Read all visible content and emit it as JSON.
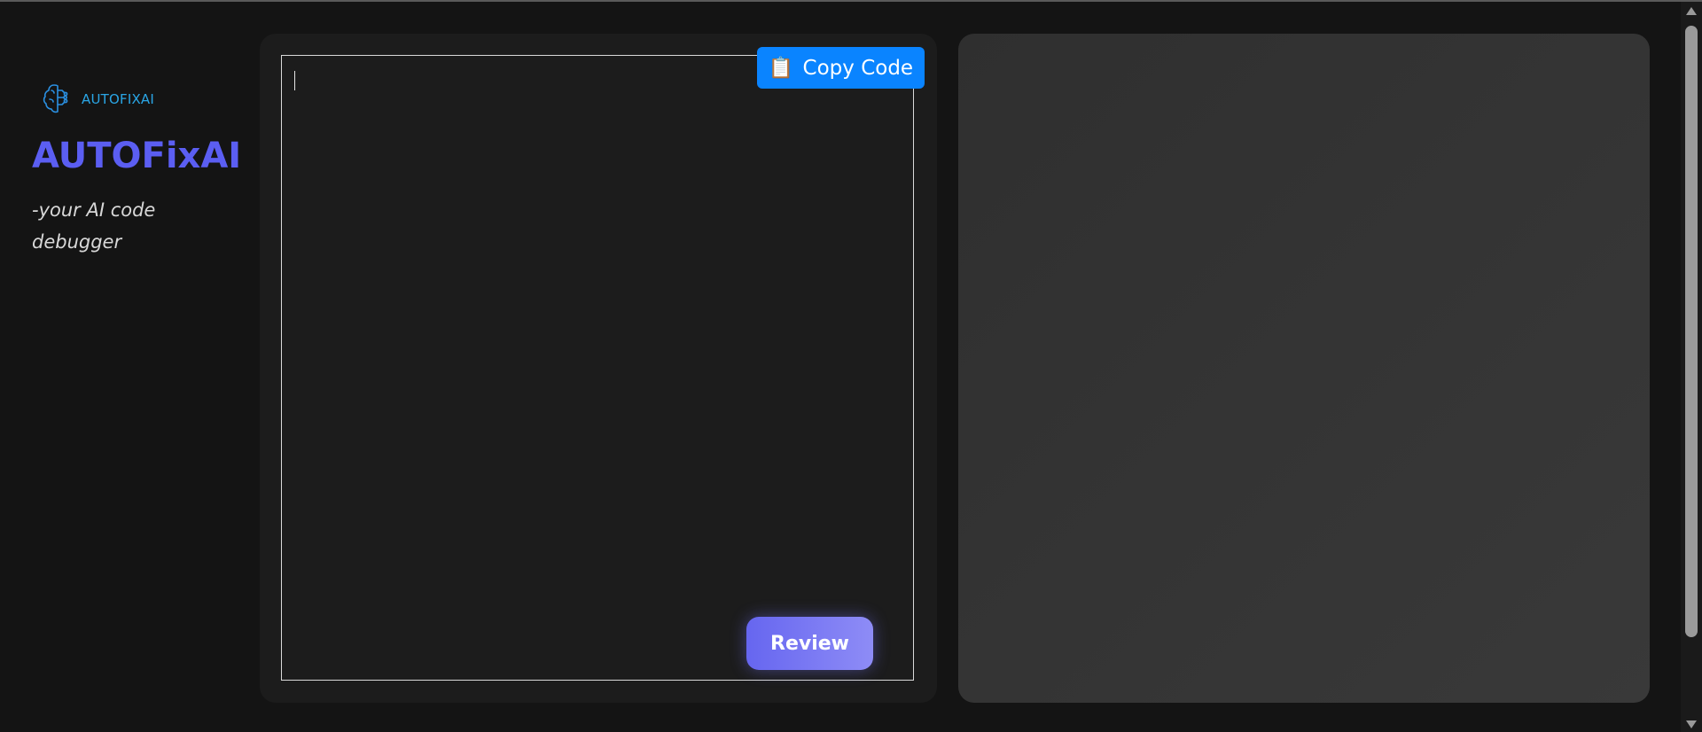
{
  "sidebar": {
    "logo_icon": "brain-circuit-icon",
    "logo_text": "AUTOFIXAI",
    "title": "AUTOFixAI",
    "subtitle": "-your AI code debugger"
  },
  "editor": {
    "value": "",
    "copy_icon": "clipboard-icon",
    "copy_icon_glyph": "📋",
    "copy_label": "Copy Code",
    "review_label": "Review"
  },
  "output": {
    "content": ""
  },
  "colors": {
    "accent": "#5b5ef2",
    "copy_button": "#0a84ff",
    "logo": "#2aa6e6"
  }
}
